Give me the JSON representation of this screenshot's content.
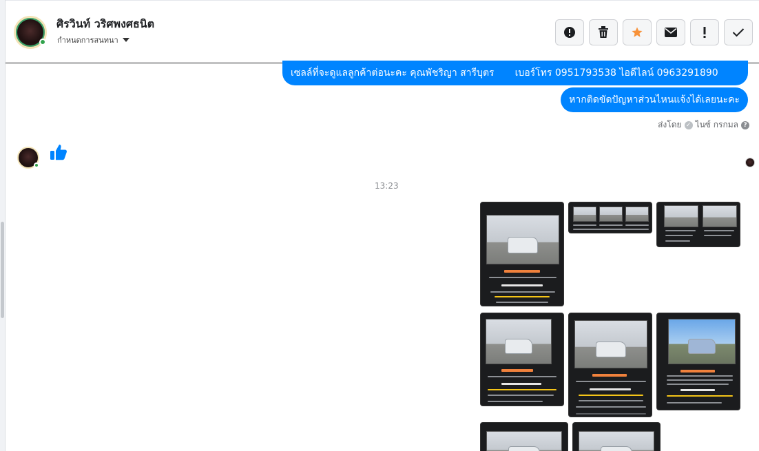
{
  "contact": {
    "name": "ศิรวินท์ วริศพงศธนิต",
    "assign_label": "กำหนดการสนทนา"
  },
  "toolbar": {
    "buttons": [
      {
        "icon": "alert-circle-icon"
      },
      {
        "icon": "trash-icon"
      },
      {
        "icon": "star-icon",
        "color": "#f7923a"
      },
      {
        "icon": "envelope-icon"
      },
      {
        "icon": "exclamation-icon"
      },
      {
        "icon": "checkmark-icon"
      }
    ]
  },
  "messages": {
    "outgoing_1_part1": "เซลล์ที่จะดูแลลูกค้าต่อนะคะ คุณพัชริญา สารีบุตร",
    "outgoing_1_part2": "เบอร์โทร 0951793538 ไอดีไลน์ 0963291890",
    "outgoing_2": "หากติดขัดปัญหาส่วนไหนแจ้งได้เลยนะคะ",
    "sent_by_label": "ส่งโดย",
    "sent_by_name": "ไนซ์ กรกมล",
    "help_glyph": "?",
    "timestamp": "13:23"
  },
  "colors": {
    "bubble": "#0084ff",
    "like": "#0084ff",
    "price": "#f0813c"
  }
}
